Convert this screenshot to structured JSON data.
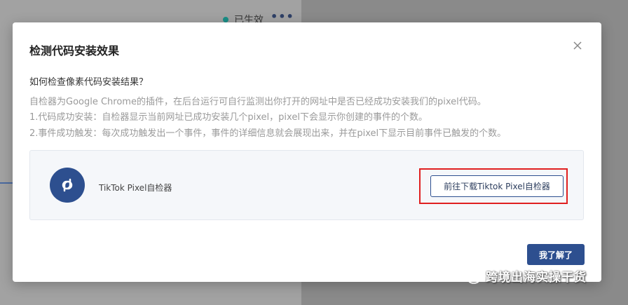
{
  "background": {
    "status_label": "已生效",
    "more_label": "•••"
  },
  "modal": {
    "title": "检测代码安装效果",
    "close_label": "×",
    "question": "如何检查像素代码安装结果？",
    "description": [
      "自检器为Google Chrome的插件，在后台运行可自行监测出你打开的网址中是否已经成功安装我们的pixel代码。",
      "1.代码成功安装：自检器显示当前网址已成功安装几个pixel，pixel下会显示你创建的事件的个数。",
      "2.事件成功触发：每次成功触发出一个事件，事件的详细信息就会展现出来，并在pixel下显示目前事件已触发的个数。"
    ],
    "extension": {
      "name": "TikTok Pixel自检器",
      "icon": "pixel-link-icon",
      "download_label": "前往下载Tiktok Pixel自检器"
    },
    "confirm_label": "我了解了"
  },
  "watermark": {
    "text": "跨境出海实操干货",
    "icon": "wechat-icon"
  },
  "colors": {
    "primary": "#2d4f8f",
    "highlight": "#e02020",
    "status_dot": "#1a8f87",
    "muted_text": "#9a9a9a"
  }
}
